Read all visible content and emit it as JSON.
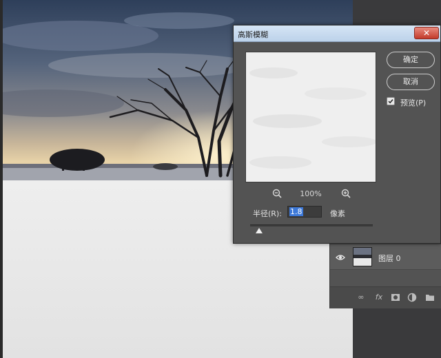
{
  "dialog": {
    "title": "高斯模糊",
    "close_label": "✕",
    "ok_label": "确定",
    "cancel_label": "取消",
    "preview_checkbox_label": "预览(P)",
    "preview_checked": true,
    "zoom_level": "100%",
    "radius_label": "半径(R):",
    "radius_value": "1.8",
    "radius_unit": "像素"
  },
  "layers": {
    "items": [
      {
        "name": "图层 0",
        "visible": true
      }
    ]
  },
  "colors": {
    "dialog_bg": "#535353",
    "titlebar": "#cfe0f3",
    "close_button": "#c94536",
    "selection": "#3c78d8"
  },
  "icons": {
    "zoom_out": "zoom-out-icon",
    "zoom_in": "zoom-in-icon",
    "visibility": "eye-icon",
    "link": "link-icon",
    "fx": "fx-icon",
    "mask": "mask-icon",
    "adjustment": "adjustment-icon",
    "folder": "folder-icon"
  }
}
